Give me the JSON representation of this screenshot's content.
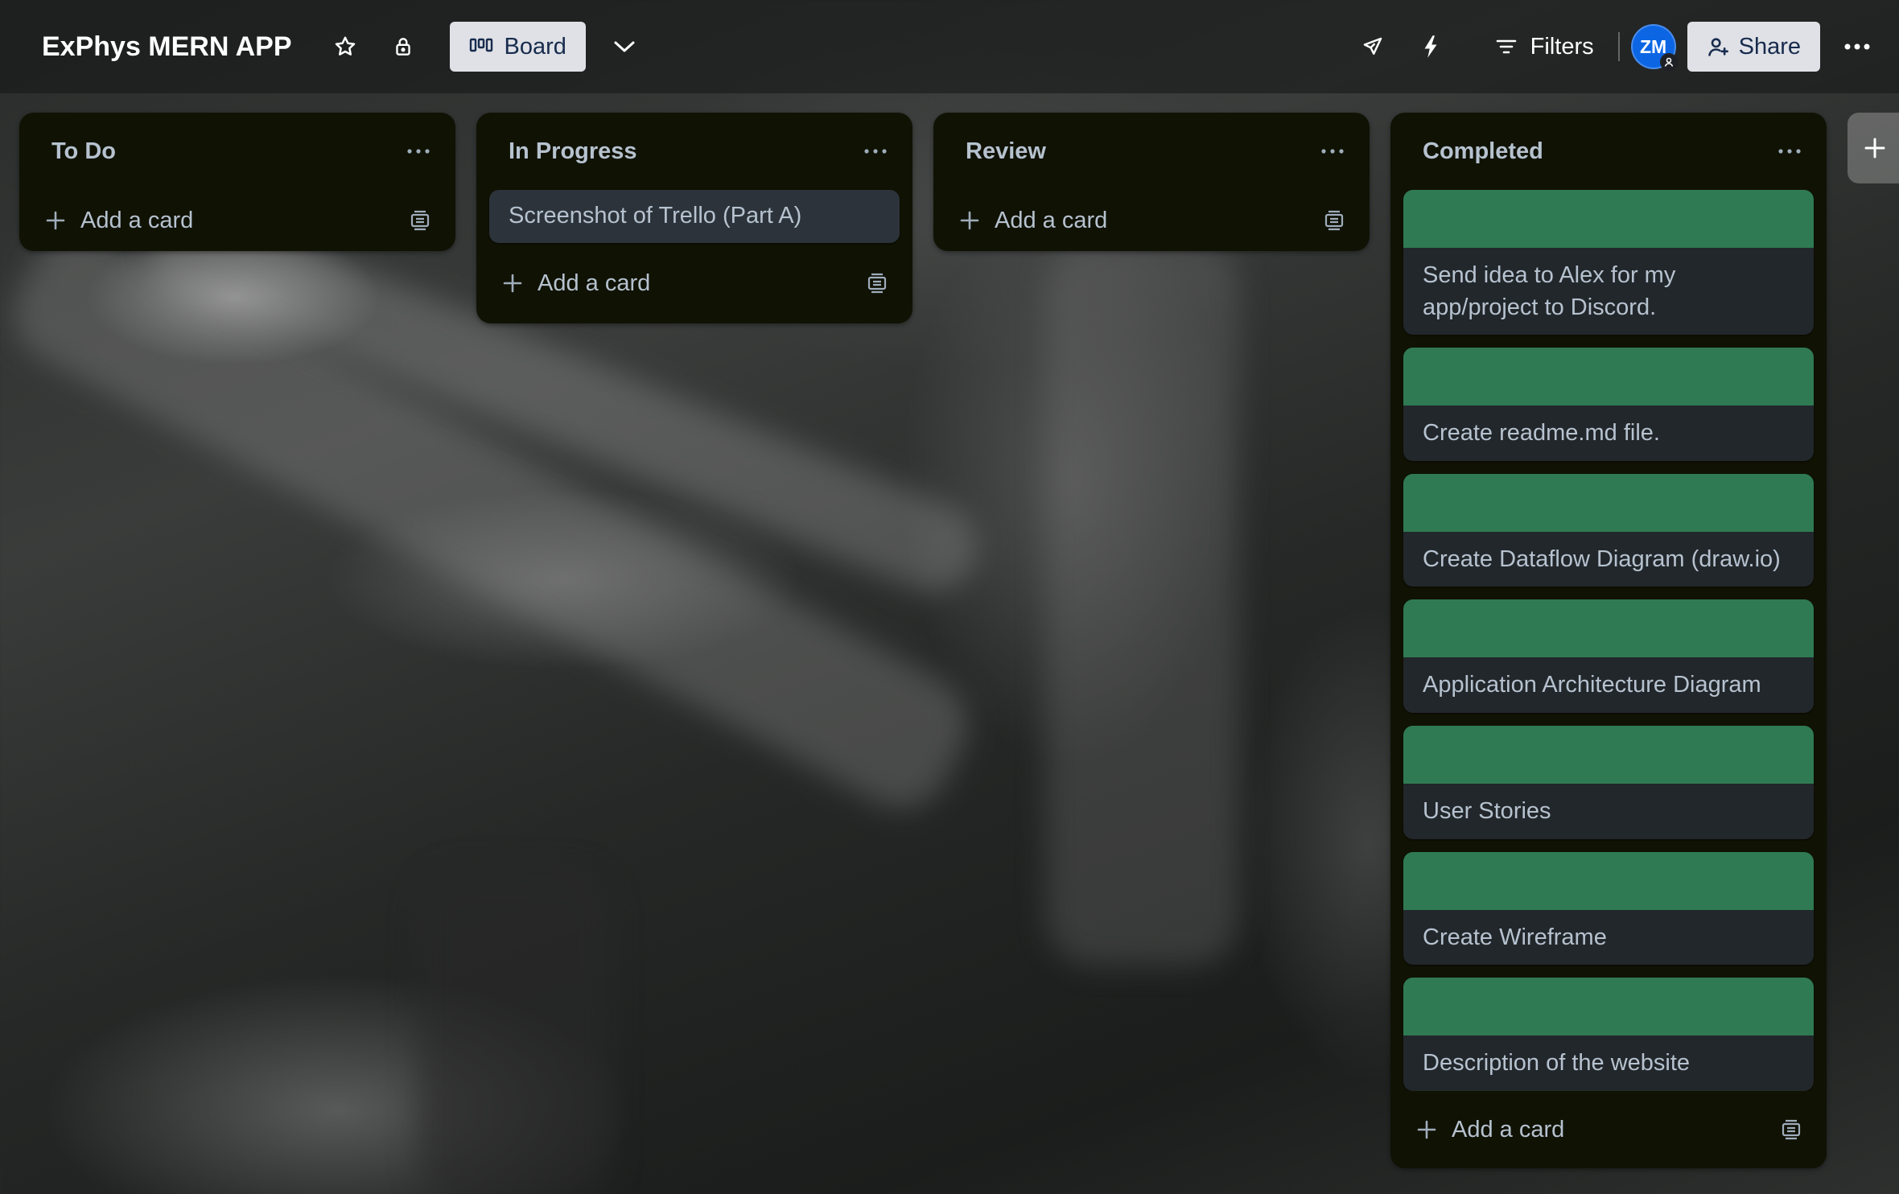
{
  "board": {
    "title": "ExPhys MERN APP",
    "view_label": "Board",
    "filters_label": "Filters",
    "share_label": "Share",
    "member_initials": "ZM"
  },
  "colors": {
    "card_cover": "#2f7a52",
    "list_bg": "#101204",
    "card_bg": "#22272b",
    "avatar": "#0c66e4"
  },
  "icons": [
    "star-icon",
    "lock-icon",
    "board-view-icon",
    "chevron-down-icon",
    "rocket-icon",
    "lightning-icon",
    "filter-icon",
    "share-person-icon",
    "more-icon",
    "template-icon",
    "plus-icon"
  ],
  "lists": [
    {
      "title": "To Do",
      "cards": [],
      "add_label": "Add a card"
    },
    {
      "title": "In Progress",
      "cards": [
        {
          "title": "Screenshot of Trello (Part A)"
        }
      ],
      "add_label": "Add a card"
    },
    {
      "title": "Review",
      "cards": [],
      "add_label": "Add a card"
    },
    {
      "title": "Completed",
      "cards": [
        {
          "title": "Send idea to Alex for my app/project to Discord."
        },
        {
          "title": "Create readme.md file."
        },
        {
          "title": "Create Dataflow Diagram (draw.io)"
        },
        {
          "title": "Application Architecture Diagram"
        },
        {
          "title": "User Stories"
        },
        {
          "title": "Create Wireframe"
        },
        {
          "title": "Description of the website"
        }
      ],
      "add_label": "Add a card"
    }
  ]
}
